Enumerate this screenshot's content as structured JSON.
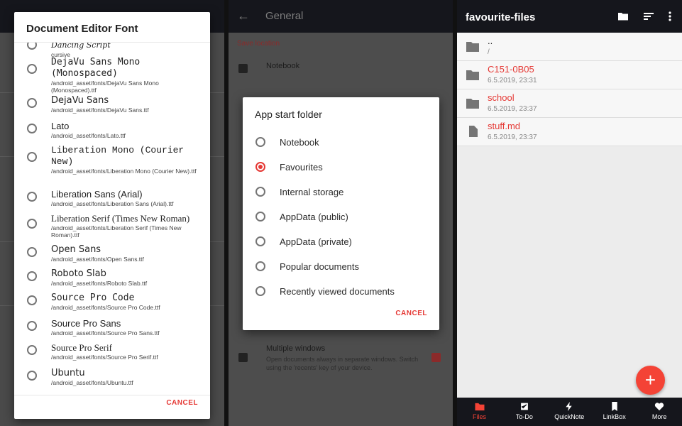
{
  "font_dialog": {
    "title": "Document Editor Font",
    "cancel_label": "CANCEL",
    "fonts": [
      {
        "name": "Dancing Script",
        "path": "cursive"
      },
      {
        "name": "DejaVu Sans Mono (Monospaced)",
        "path": "/android_asset/fonts/DejaVu Sans Mono (Monospaced).ttf"
      },
      {
        "name": "DejaVu Sans",
        "path": "/android_asset/fonts/DejaVu Sans.ttf"
      },
      {
        "name": "Lato",
        "path": "/android_asset/fonts/Lato.ttf"
      },
      {
        "name": "Liberation Mono (Courier New)",
        "path": "/android_asset/fonts/Liberation Mono (Courier New).ttf"
      },
      {
        "name": "Liberation Sans (Arial)",
        "path": "/android_asset/fonts/Liberation Sans (Arial).ttf"
      },
      {
        "name": "Liberation Serif (Times New Roman)",
        "path": "/android_asset/fonts/Liberation Serif (Times New Roman).ttf"
      },
      {
        "name": "Open Sans",
        "path": "/android_asset/fonts/Open Sans.ttf"
      },
      {
        "name": "Roboto Slab",
        "path": "/android_asset/fonts/Roboto Slab.ttf"
      },
      {
        "name": "Source Pro Code",
        "path": "/android_asset/fonts/Source Pro Code.ttf"
      },
      {
        "name": "Source Pro Sans",
        "path": "/android_asset/fonts/Source Pro Sans.ttf"
      },
      {
        "name": "Source Pro Serif",
        "path": "/android_asset/fonts/Source Pro Serif.ttf"
      },
      {
        "name": "Ubuntu",
        "path": "/android_asset/fonts/Ubuntu.ttf"
      }
    ]
  },
  "general": {
    "back_icon": "arrow-back-icon",
    "title": "General",
    "section_label": "Save location",
    "notebook_label": "Notebook",
    "multiple_windows_label": "Multiple windows",
    "multiple_windows_desc": "Open documents always in separate windows. Switch using the 'recents' key of your device."
  },
  "folder_dialog": {
    "title": "App start folder",
    "cancel_label": "CANCEL",
    "options": [
      {
        "label": "Notebook",
        "selected": false
      },
      {
        "label": "Favourites",
        "selected": true
      },
      {
        "label": "Internal storage",
        "selected": false
      },
      {
        "label": "AppData (public)",
        "selected": false
      },
      {
        "label": "AppData (private)",
        "selected": false
      },
      {
        "label": "Popular documents",
        "selected": false
      },
      {
        "label": "Recently viewed documents",
        "selected": false
      }
    ]
  },
  "files": {
    "title": "favourite-files",
    "toolbar_icons": [
      "folder-icon",
      "sort-icon",
      "more-vert-icon"
    ],
    "entries": [
      {
        "name": "..",
        "detail": "/",
        "type": "folder",
        "highlight": false
      },
      {
        "name": "C151-0B05",
        "detail": "6.5.2019, 23:31",
        "type": "folder",
        "highlight": true
      },
      {
        "name": "school",
        "detail": "6.5.2019, 23:37",
        "type": "folder",
        "highlight": true
      },
      {
        "name": "stuff.md",
        "detail": "6.5.2019, 23:37",
        "type": "file",
        "highlight": true
      }
    ],
    "fab_label": "+",
    "nav": [
      {
        "label": "Files",
        "icon": "folder-icon",
        "active": true
      },
      {
        "label": "To-Do",
        "icon": "checklist-icon",
        "active": false
      },
      {
        "label": "QuickNote",
        "icon": "flash-icon",
        "active": false
      },
      {
        "label": "LinkBox",
        "icon": "bookmark-icon",
        "active": false
      },
      {
        "label": "More",
        "icon": "heart-icon",
        "active": false
      }
    ]
  },
  "colors": {
    "accent": "#e53935",
    "toolbar": "#15161c"
  }
}
